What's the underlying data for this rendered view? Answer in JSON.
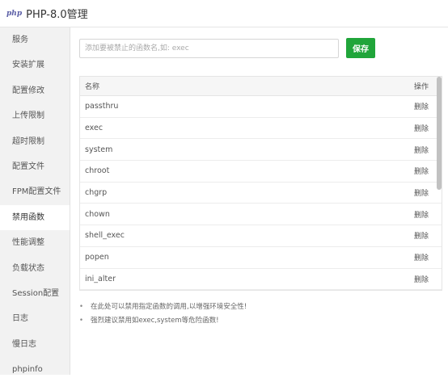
{
  "window": {
    "logo_text": "php",
    "title": "PHP-8.0管理"
  },
  "sidebar": {
    "items": [
      {
        "label": "服务"
      },
      {
        "label": "安装扩展"
      },
      {
        "label": "配置修改"
      },
      {
        "label": "上传限制"
      },
      {
        "label": "超时限制"
      },
      {
        "label": "配置文件"
      },
      {
        "label": "FPM配置文件"
      },
      {
        "label": "禁用函数",
        "active": true
      },
      {
        "label": "性能调整"
      },
      {
        "label": "负载状态"
      },
      {
        "label": "Session配置"
      },
      {
        "label": "日志"
      },
      {
        "label": "慢日志"
      },
      {
        "label": "phpinfo"
      }
    ]
  },
  "form": {
    "input_placeholder": "添加要被禁止的函数名,如: exec",
    "input_value": "",
    "save_label": "保存"
  },
  "table": {
    "headers": {
      "name": "名称",
      "action": "操作"
    },
    "rows": [
      {
        "name": "passthru",
        "action": "删除"
      },
      {
        "name": "exec",
        "action": "删除"
      },
      {
        "name": "system",
        "action": "删除"
      },
      {
        "name": "chroot",
        "action": "删除"
      },
      {
        "name": "chgrp",
        "action": "删除"
      },
      {
        "name": "chown",
        "action": "删除"
      },
      {
        "name": "shell_exec",
        "action": "删除"
      },
      {
        "name": "popen",
        "action": "删除"
      },
      {
        "name": "ini_alter",
        "action": "删除"
      }
    ]
  },
  "notes": [
    "在此处可以禁用指定函数的调用,以增强环境安全性!",
    "强烈建议禁用如exec,system等危险函数!"
  ],
  "colors": {
    "accent": "#20a53a",
    "sidebar_bg": "#f2f2f2"
  }
}
